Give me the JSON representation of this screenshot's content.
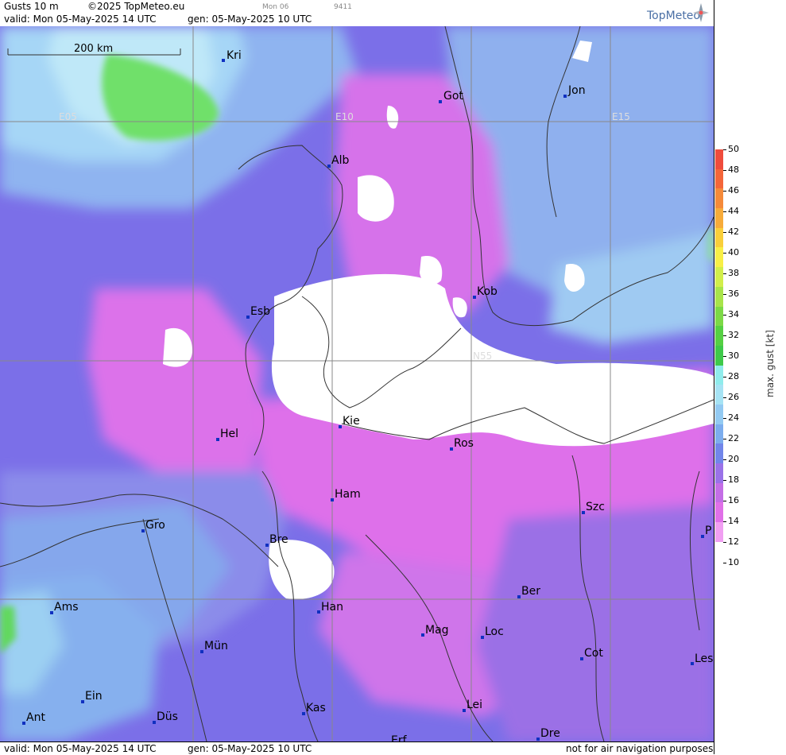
{
  "header": {
    "product": "Gusts 10 m",
    "copyright": "©2025 TopMeteo.eu",
    "day": "Mon 06",
    "code": "9411",
    "valid": "valid:  Mon  05-May-2025  14 UTC",
    "gen": "gen: 05-May-2025 10 UTC",
    "logo": "TopMeteo"
  },
  "footer": {
    "valid": "valid:  Mon  05-May-2025  14 UTC",
    "gen": "gen: 05-May-2025 10 UTC",
    "note": "not for air navigation purposes"
  },
  "map": {
    "scale": "200 km",
    "grid_labels": [
      "E05",
      "E10",
      "E15",
      "N55"
    ],
    "cities": [
      "Kri",
      "Got",
      "Jon",
      "Alb",
      "Kob",
      "Esb",
      "Kie",
      "Hel",
      "Ros",
      "Ham",
      "Szc",
      "Gro",
      "Bre",
      "P",
      "Ber",
      "Ams",
      "Han",
      "Mag",
      "Loc",
      "Mün",
      "Cot",
      "Les",
      "Ein",
      "Kas",
      "Lei",
      "Ant",
      "Düs",
      "Dre",
      "Erf"
    ]
  },
  "legend": {
    "title": "max. gust [kt]",
    "ticks": [
      "50",
      "48",
      "46",
      "44",
      "42",
      "40",
      "38",
      "36",
      "34",
      "32",
      "30",
      "28",
      "26",
      "24",
      "22",
      "20",
      "18",
      "16",
      "14",
      "12",
      "10"
    ],
    "colors": [
      "#ef4c3c",
      "#f4663a",
      "#f58a3a",
      "#f7ab3a",
      "#f9cf3a",
      "#f8ef46",
      "#d2ee4a",
      "#a8e44a",
      "#7cd946",
      "#55d043",
      "#3ec94a",
      "#90ecec",
      "#a6e3f4",
      "#93caf2",
      "#7cadee",
      "#7186ea",
      "#9a72e8",
      "#c46ee6",
      "#e070e8",
      "#f19ff2"
    ]
  }
}
